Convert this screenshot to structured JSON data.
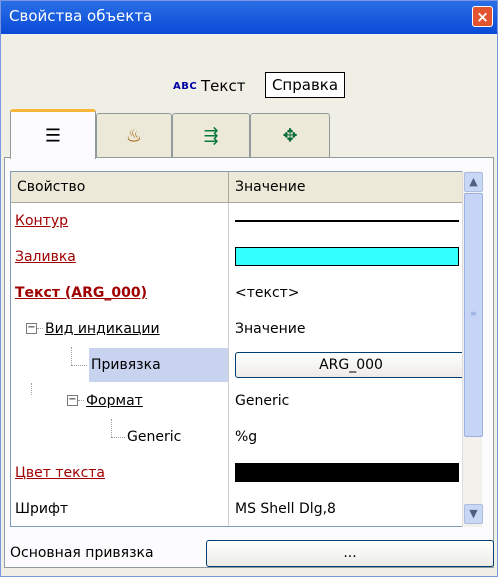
{
  "window": {
    "title": "Свойства объекта",
    "close_label": "×"
  },
  "object": {
    "type_icon": "ABC",
    "name": "Текст",
    "help_label": "Справка"
  },
  "tabs": [
    {
      "icon": "list-properties-icon",
      "glyph": "☰",
      "active": true
    },
    {
      "icon": "paint-bucket-icon",
      "glyph": "♨",
      "active": false
    },
    {
      "icon": "binding-icon",
      "glyph": "⇶",
      "active": false
    },
    {
      "icon": "move-arrows-icon",
      "glyph": "✥",
      "active": false
    }
  ],
  "grid": {
    "headers": {
      "property": "Свойство",
      "value": "Значение"
    },
    "rows": [
      {
        "key": "Контур",
        "value": ""
      },
      {
        "key": "Заливка",
        "value": ""
      },
      {
        "key": "Текст (ARG_000)",
        "value": "<текст>"
      },
      {
        "key": "Вид индикации",
        "value": "Значение"
      },
      {
        "key": "Привязка",
        "value": "ARG_000"
      },
      {
        "key": "Формат",
        "value": "Generic"
      },
      {
        "key": "Generic",
        "value": "%g"
      },
      {
        "key": "Цвет текста",
        "value": ""
      },
      {
        "key": "Шрифт",
        "value": "MS Shell Dlg,8"
      }
    ],
    "fill_color": "#33ffff",
    "text_color": "#000000"
  },
  "bottom": {
    "label": "Основная привязка",
    "button_label": "..."
  },
  "colors": {
    "titlebar": "#0a4ad6",
    "link": "#a00000",
    "selected_row": "#c7d3ef"
  }
}
